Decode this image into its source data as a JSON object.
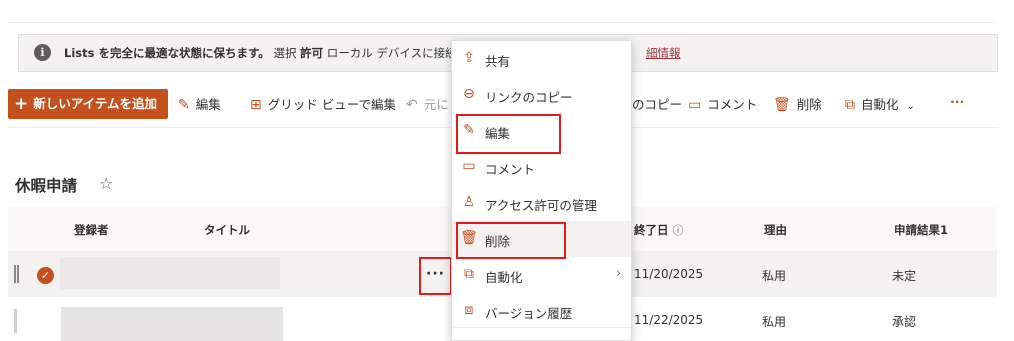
{
  "banner": {
    "text_bold": "Lists を完全に最適な状態に保ちます。",
    "text_mid": "選択",
    "text_bold2": "許可",
    "text_rest": "ローカル デバイスに接続して",
    "link": "細情報"
  },
  "toolbar": {
    "new_item": "新しいアイテムを追加",
    "edit": "編集",
    "grid_edit": "グリッド ビューで編集",
    "undo": "元に",
    "copy_link": "のコピー",
    "comment": "コメント",
    "delete": "削除",
    "automate": "自動化",
    "more": "···"
  },
  "list": {
    "title": "休暇申請",
    "columns": [
      "登録者",
      "タイトル",
      "終了日",
      "理由",
      "申請結果1"
    ],
    "rows": [
      {
        "end_date": "11/20/2025",
        "reason": "私用",
        "result": "未定"
      },
      {
        "end_date": "11/22/2025",
        "reason": "私用",
        "result": "承認"
      }
    ],
    "row_more": "···"
  },
  "context_menu": {
    "items": [
      {
        "label": "共有",
        "icon": "share-icon"
      },
      {
        "label": "リンクのコピー",
        "icon": "link-icon"
      },
      {
        "label": "編集",
        "icon": "pencil-icon"
      },
      {
        "label": "コメント",
        "icon": "comment-icon"
      },
      {
        "label": "アクセス許可の管理",
        "icon": "person-icon"
      },
      {
        "label": "削除",
        "icon": "trash-icon"
      },
      {
        "label": "自動化",
        "icon": "flow-icon"
      },
      {
        "label": "バージョン履歴",
        "icon": "history-icon"
      }
    ]
  },
  "colors": {
    "accent": "#c4501e",
    "highlight_box": "#e01b1b"
  }
}
